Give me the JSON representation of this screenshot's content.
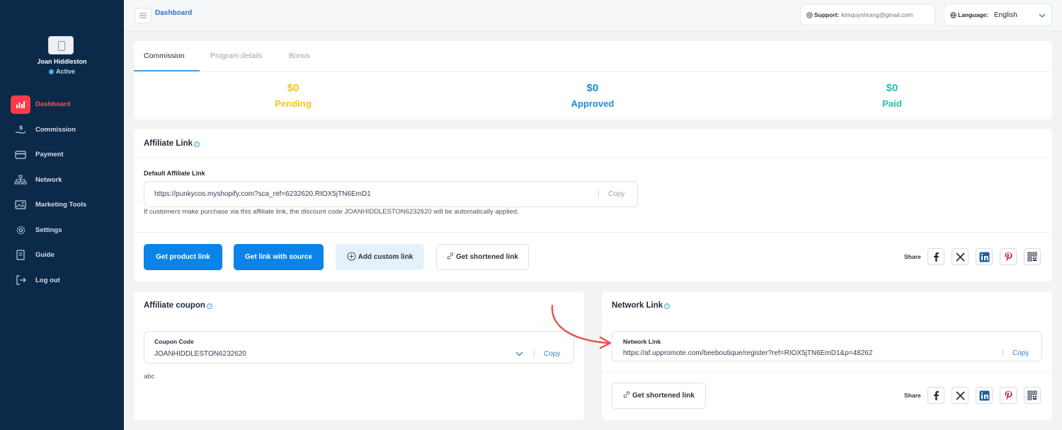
{
  "sidebar": {
    "user_name": "Joan Hiddleston",
    "user_status": "Active",
    "items": [
      {
        "label": "Dashboard",
        "icon": "chart-icon"
      },
      {
        "label": "Commission",
        "icon": "money-hand-icon"
      },
      {
        "label": "Payment",
        "icon": "credit-card-icon"
      },
      {
        "label": "Network",
        "icon": "network-icon"
      },
      {
        "label": "Marketing Tools",
        "icon": "image-icon"
      },
      {
        "label": "Settings",
        "icon": "gear-icon"
      },
      {
        "label": "Guide",
        "icon": "book-icon"
      },
      {
        "label": "Log out",
        "icon": "logout-icon"
      }
    ]
  },
  "topbar": {
    "breadcrumb": "Dashboard",
    "support_label": "Support:",
    "support_email": "kimquynhrang@gmail.com",
    "language_label": "Language:",
    "language_value": "English"
  },
  "commission": {
    "tabs": [
      "Commission",
      "Program details",
      "Bonus"
    ],
    "stats": [
      {
        "amount": "$0",
        "label": "Pending",
        "color": "#f5c518"
      },
      {
        "amount": "$0",
        "label": "Approved",
        "color": "#1a8fd6"
      },
      {
        "amount": "$0",
        "label": "Paid",
        "color": "#1fc3b0"
      }
    ]
  },
  "affiliate_link": {
    "title": "Affiliate Link",
    "field_label": "Default Affiliate Link",
    "url": "https://punkycos.myshopify.com?sca_ref=6232620.RIOX5jTN6EmD1",
    "copy_label": "Copy",
    "note": "If customers make purchase via this affiliate link, the discount code JOANHIDDLESTON6232620 will be automatically applied.",
    "buttons": {
      "product_link": "Get product link",
      "link_with_source": "Get link with source",
      "custom_link": "Add custom link",
      "shortened_link": "Get shortened link"
    },
    "share_label": "Share"
  },
  "affiliate_coupon": {
    "title": "Affiliate coupon",
    "field_label": "Coupon Code",
    "code": "JOANHIDDLESTON6232620",
    "copy_label": "Copy",
    "note": "abc"
  },
  "network_link": {
    "title": "Network Link",
    "field_label": "Network Link",
    "url": "https://af.uppromote.com/beeboutique/register?ref=RIOX5jTN6EmD1&p=48262",
    "copy_label": "Copy",
    "shortened_link": "Get shortened link",
    "share_label": "Share"
  },
  "share_icons": [
    "facebook-icon",
    "x-icon",
    "linkedin-icon",
    "pinterest-icon",
    "qr-code-icon"
  ],
  "colors": {
    "sidebar_bg": "#0b2a4a",
    "accent_red": "#ff3b4b",
    "primary_blue": "#0a84e8",
    "arrow_red": "#e8524a"
  }
}
